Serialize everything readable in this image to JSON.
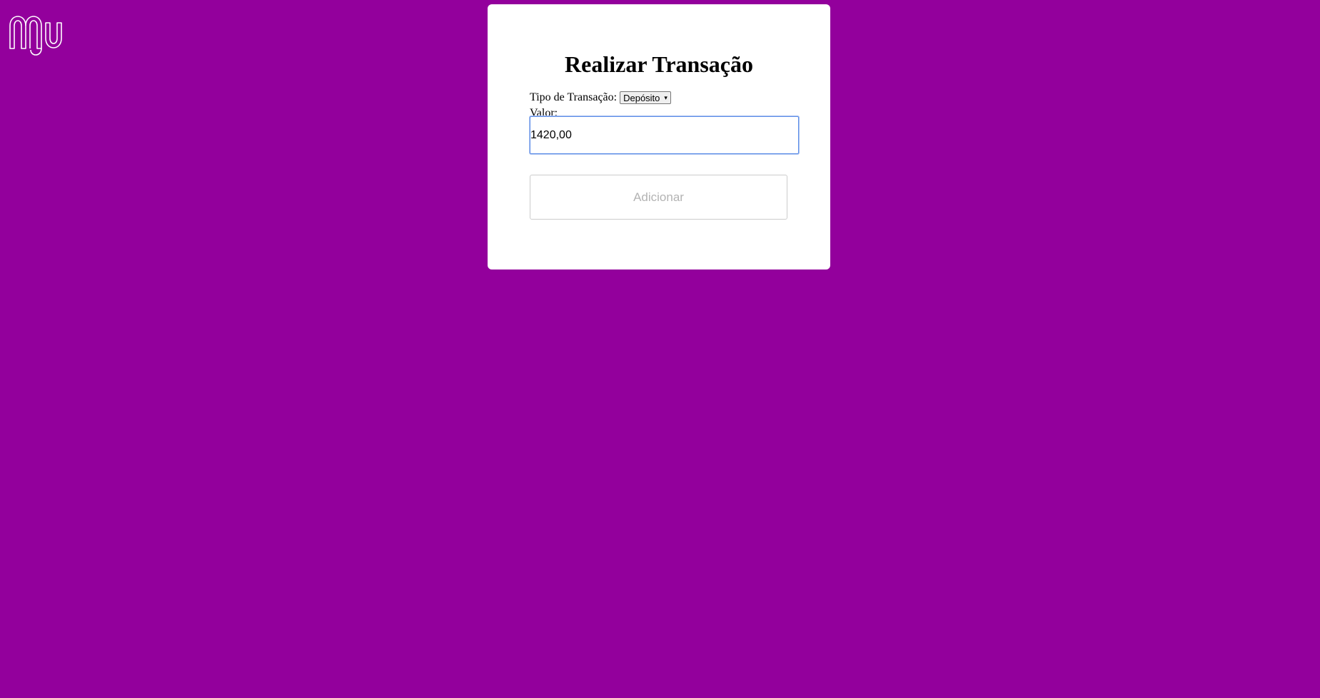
{
  "brand": {
    "logo_icon": "nubank-logo-icon",
    "logo_color": "#ffffff"
  },
  "colors": {
    "background": "#93009c",
    "card": "#ffffff",
    "input_focus_border": "#5e8ee8",
    "button_text_disabled": "#b3b3b3"
  },
  "form": {
    "title": "Realizar Transação",
    "type_label": "Tipo de Transação:",
    "type_selected": "Depósito",
    "type_chevron_icon": "▾",
    "value_label": "Valor:",
    "value_input": "1420,00",
    "submit_label": "Adicionar"
  }
}
